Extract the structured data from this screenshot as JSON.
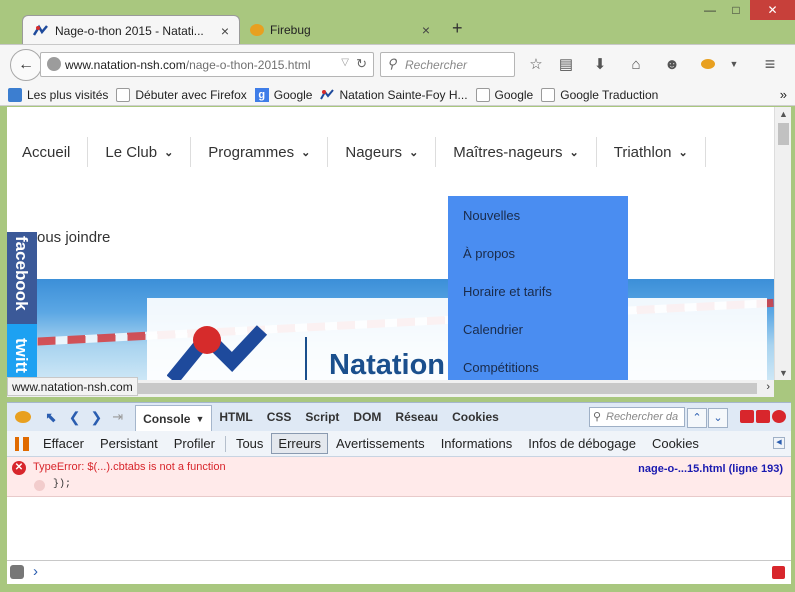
{
  "tabs": [
    {
      "title": "Nage-o-thon 2015 - Natati...",
      "active": true
    },
    {
      "title": "Firebug",
      "active": false
    }
  ],
  "new_tab_label": "+",
  "tab_close_glyph": "×",
  "window_controls": {
    "minimize": "—",
    "maximize": "□",
    "close": "✕"
  },
  "navbar": {
    "url_host": "www.natation-nsh.com",
    "url_path": "/nage-o-thon-2015.html",
    "search_placeholder": "Rechercher",
    "back_glyph": "←",
    "forward_glyph": "→"
  },
  "bookmarks": [
    {
      "label": "Les plus visités",
      "icon": "bookmark-icon"
    },
    {
      "label": "Débuter avec Firefox",
      "icon": "blank-page-icon"
    },
    {
      "label": "Google",
      "icon": "google-icon"
    },
    {
      "label": "Natation Sainte-Foy H...",
      "icon": "natation-logo-icon"
    },
    {
      "label": "Google",
      "icon": "blank-page-icon"
    },
    {
      "label": "Google Traduction",
      "icon": "blank-page-icon"
    }
  ],
  "bookmarks_overflow": "»",
  "site_nav": [
    {
      "label": "Accueil",
      "dropdown": false
    },
    {
      "label": "Le Club",
      "dropdown": true
    },
    {
      "label": "Programmes",
      "dropdown": true
    },
    {
      "label": "Nageurs",
      "dropdown": true
    },
    {
      "label": "Maîtres-nageurs",
      "dropdown": true
    },
    {
      "label": "Triathlon",
      "dropdown": true
    }
  ],
  "dropdown_items": [
    "Nouvelles",
    "À propos",
    "Horaire et tarifs",
    "Calendrier",
    "Compétitions"
  ],
  "nous_joindre": "ous joindre",
  "social": {
    "facebook": "facebook",
    "twitter": "twitt"
  },
  "logo_text": "Natation",
  "status_url": "www.natation-nsh.com",
  "firebug": {
    "panels": [
      "Console",
      "HTML",
      "CSS",
      "Script",
      "DOM",
      "Réseau",
      "Cookies"
    ],
    "selected_panel": "Console",
    "search_placeholder": "Rechercher da",
    "console_buttons": [
      "Effacer",
      "Persistant",
      "Profiler"
    ],
    "filters": [
      "Tous",
      "Erreurs",
      "Avertissements",
      "Informations",
      "Infos de débogage",
      "Cookies"
    ],
    "selected_filter": "Erreurs",
    "error": {
      "message": "TypeError: $(...).cbtabs is not a function",
      "source": "nage-o-...15.html (ligne 193)",
      "code": "});"
    },
    "cmd_prompt": "›"
  },
  "colors": {
    "chrome_green": "#a9c77f",
    "dropdown_blue": "#4a8df1",
    "error_red": "#d8262c",
    "source_blue": "#1a1ab0"
  }
}
